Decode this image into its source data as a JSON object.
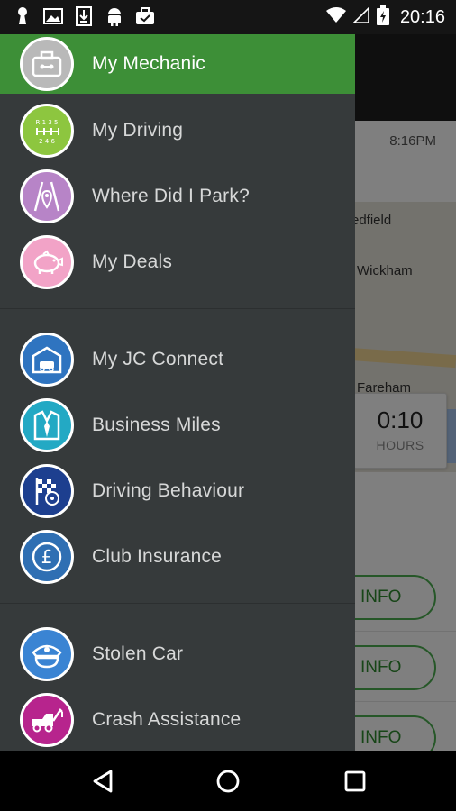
{
  "status_bar": {
    "time": "20:16",
    "left_icons": [
      "keyhole-icon",
      "image-icon",
      "download-icon",
      "android-icon",
      "briefcase-check-icon"
    ],
    "right_icons": [
      "wifi-icon",
      "signal-icon",
      "battery-charging-icon"
    ]
  },
  "background_app": {
    "row_time": "8:16PM",
    "map_labels": [
      "edfield",
      "Wickham",
      "Fareham"
    ],
    "duration_value": "0:10",
    "duration_unit": "HOURS",
    "info_buttons": [
      "INFO",
      "INFO",
      "INFO"
    ]
  },
  "drawer": {
    "items": [
      {
        "label": "My Mechanic",
        "icon": "toolbox-icon",
        "color": "#b9b9b9",
        "active": true
      },
      {
        "label": "My Driving",
        "icon": "gear-shift-icon",
        "color": "#8dc63f",
        "active": false
      },
      {
        "label": "Where Did I Park?",
        "icon": "map-pin-road-icon",
        "color": "#b784c7",
        "active": false
      },
      {
        "label": "My Deals",
        "icon": "piggy-bank-icon",
        "color": "#f2a3c7",
        "active": false
      },
      {
        "label": "My JC Connect",
        "icon": "garage-car-icon",
        "color": "#2f74c0",
        "active": false
      },
      {
        "label": "Business Miles",
        "icon": "suit-icon",
        "color": "#23a9c4",
        "active": false
      },
      {
        "label": "Driving Behaviour",
        "icon": "checkered-flag-icon",
        "color": "#1d3f8f",
        "active": false
      },
      {
        "label": "Club Insurance",
        "icon": "pound-coin-icon",
        "color": "#2f6fb3",
        "active": false
      },
      {
        "label": "Stolen Car",
        "icon": "police-hat-icon",
        "color": "#3a84d3",
        "active": false
      },
      {
        "label": "Crash Assistance",
        "icon": "tow-truck-icon",
        "color": "#b7248d",
        "active": false
      }
    ]
  },
  "nav_bar": {
    "back": "back-icon",
    "home": "home-icon",
    "recents": "recents-icon"
  }
}
